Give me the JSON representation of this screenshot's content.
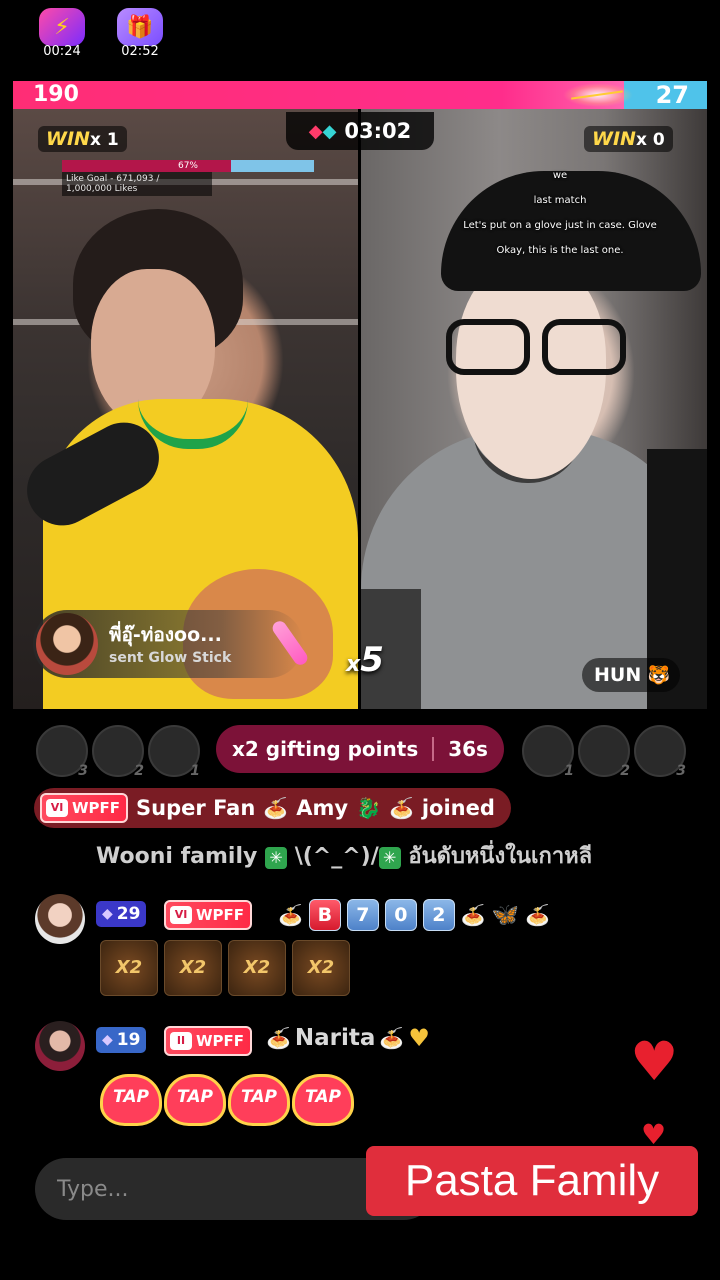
{
  "top_badges": [
    {
      "icon": "lightning-icon",
      "time": "00:24"
    },
    {
      "icon": "gift-box-icon",
      "time": "02:52"
    }
  ],
  "battle": {
    "score_left": "190",
    "score_right": "27",
    "timer": "03:02",
    "win_left_label": "WIN",
    "win_left_count": "x 1",
    "win_right_label": "WIN",
    "win_right_count": "x 0",
    "colors": {
      "left": "#ff2d75",
      "right": "#4fc3ea"
    }
  },
  "like_goal": {
    "percent_label": "67%",
    "progress": 0.67,
    "caption": "Like Goal - 671,093 / 1,000,000 Likes"
  },
  "captions": [
    "we",
    "last match",
    "Let's put on a glove just in case. Glove",
    "Okay, this is the last one."
  ],
  "gift_notice": {
    "sender": "พี่อุ๊-ท่องoo...",
    "action": "sent Glow Stick",
    "combo_prefix": "x",
    "combo_count": "5"
  },
  "right_host": {
    "name": "HUN",
    "emoji": "🐯"
  },
  "ranking": {
    "left_ranks": [
      "3",
      "2",
      "1"
    ],
    "right_ranks": [
      "1",
      "2",
      "3"
    ],
    "gifting_label": "x2 gifting points",
    "gifting_time": "36s"
  },
  "joined_banner": {
    "club_level": "VI",
    "club_name": "WPFF",
    "text_prefix": "Super Fan",
    "user_name": "Amy",
    "text_suffix": "joined"
  },
  "top_message": {
    "prefix": "Wooni family",
    "kaomoji": "\\(^_^)/",
    "thai": "อันดับหนึ่งในเกาหลี"
  },
  "chat": [
    {
      "level": "29",
      "club_level": "VI",
      "club_name": "WPFF",
      "name_keys": [
        "B",
        "7",
        "0",
        "2"
      ],
      "x2_tiles": [
        "X2",
        "X2",
        "X2",
        "X2"
      ]
    },
    {
      "level": "19",
      "club_level": "II",
      "club_name": "WPFF",
      "name": "Narita",
      "tap_tiles": [
        "TAP",
        "TAP",
        "TAP",
        "TAP"
      ]
    }
  ],
  "input": {
    "placeholder": "Type..."
  },
  "overlay_caption": "Pasta Family"
}
